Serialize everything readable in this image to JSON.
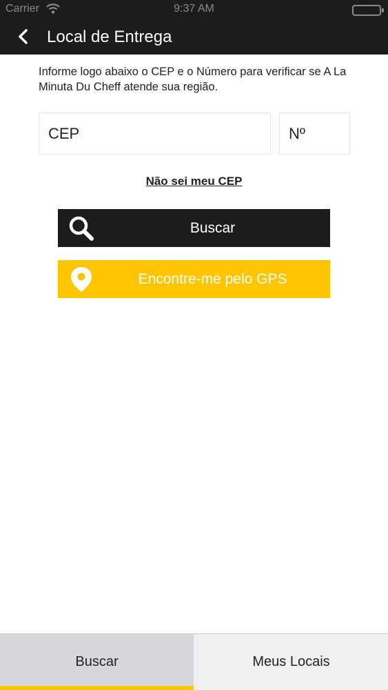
{
  "status_bar": {
    "carrier": "Carrier",
    "time": "9:37 AM",
    "icons": [
      "wifi-icon",
      "battery-icon"
    ]
  },
  "nav": {
    "title": "Local de Entrega",
    "back_icon": "chevron-left-icon"
  },
  "intro_text": "Informe logo abaixo o CEP e o Número para verificar se A La Minuta Du Cheff atende sua região.",
  "form": {
    "cep_placeholder": "CEP",
    "number_placeholder": "Nº",
    "no_cep_link": "Não sei meu CEP"
  },
  "buttons": {
    "search_label": "Buscar",
    "search_icon": "search-icon",
    "gps_label": "Encontre-me pelo GPS",
    "gps_icon": "location-pin-icon"
  },
  "tabs": [
    {
      "label": "Buscar",
      "active": true
    },
    {
      "label": "Meus Locais",
      "active": false
    }
  ],
  "colors": {
    "dark": "#1c1c1c",
    "accent_yellow": "#ffc600",
    "tab_active_bg": "#d8d8dc",
    "tab_bg": "#f0f0f2"
  }
}
